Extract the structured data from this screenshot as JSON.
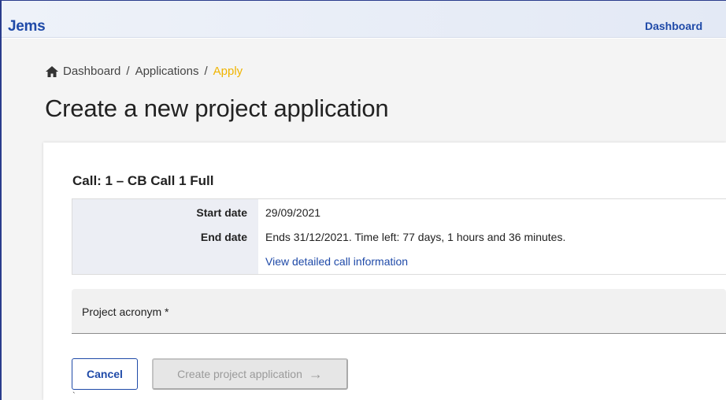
{
  "app": {
    "logo": "Jems"
  },
  "topnav": {
    "dashboard_label": "Dashboard"
  },
  "breadcrumb": {
    "items": [
      "Dashboard",
      "Applications"
    ],
    "current": "Apply",
    "separator": "/"
  },
  "page": {
    "title": "Create a new project application"
  },
  "call": {
    "title": "Call: 1 – CB Call 1 Full",
    "start_label": "Start date",
    "start_value": "29/09/2021",
    "end_label": "End date",
    "end_value": "Ends 31/12/2021. Time left: 77 days, 1 hours and 36 minutes.",
    "details_link": "View detailed call information"
  },
  "form": {
    "acronym_label": "Project acronym *",
    "acronym_value": ""
  },
  "actions": {
    "cancel_label": "Cancel",
    "create_label": "Create project application",
    "create_icon": "arrow-right-icon",
    "create_disabled": true
  },
  "colors": {
    "brand": "#1f4aa8",
    "breadcrumb_current": "#f0b400",
    "disabled_bg": "#e6e6e6"
  }
}
